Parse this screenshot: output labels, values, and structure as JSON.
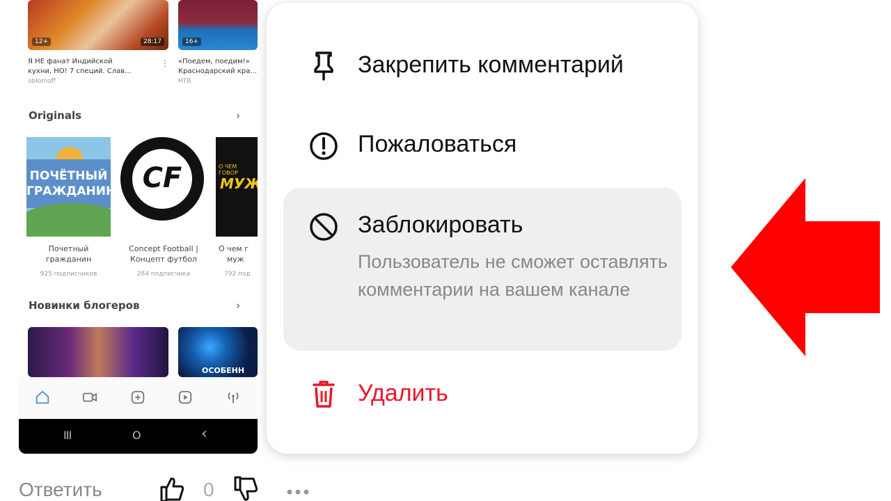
{
  "feed": {
    "videos_top": [
      {
        "title_line1": "Я НЕ фанат Индийской",
        "title_line2": "кухни, НО! 7 специй. Слав...",
        "channel": "oblomoff",
        "age": "12+",
        "duration": "28:17"
      },
      {
        "title_line1": "«Поедем, поедим!»",
        "title_line2": "Краснодарский кра...",
        "channel": "НТВ",
        "age": "16+"
      }
    ],
    "originals": {
      "title": "Originals",
      "chevron": "›",
      "cards": [
        {
          "art_text": "ПОЧЁТНЫЙ ГРАЖДАНИН",
          "name_line1": "Почетный",
          "name_line2": "гражданин",
          "subs": "925 подписчиков"
        },
        {
          "art_text": "CF",
          "name_line1": "Concept Football |",
          "name_line2": "Концепт футбол",
          "subs": "284 подписчика"
        },
        {
          "art_text": "МУЖ",
          "art_small": "О ЧЕМ ГОВОР",
          "name_line1": "О чем г",
          "name_line2": "муж",
          "subs": "792 под"
        }
      ]
    },
    "new_bloggers": {
      "title": "Новинки блогеров",
      "chevron": "›",
      "thumb2_text": "ОСОБЕНН"
    }
  },
  "tabbar": {
    "icons": [
      "home-icon",
      "camera-icon",
      "add-icon",
      "play-icon",
      "broadcast-icon"
    ]
  },
  "sysnav": {
    "recent": "III",
    "home": "O",
    "back": "‹"
  },
  "menu": {
    "items": [
      {
        "label": "Закрепить комментарий",
        "icon": "pin-icon"
      },
      {
        "label": "Пожаловаться",
        "icon": "report-icon"
      },
      {
        "label": "Заблокировать",
        "icon": "block-icon",
        "description": "Пользователь не сможет оставлять комментарии на вашем канале",
        "highlighted": true
      },
      {
        "label": "Удалить",
        "icon": "trash-icon",
        "color": "#e8172a"
      }
    ]
  },
  "comment_bar": {
    "reply_label": "Ответить",
    "likes": "0",
    "more_icon": "more-dots-icon"
  },
  "annotation": {
    "arrow_color": "#ff0000",
    "direction": "left"
  }
}
